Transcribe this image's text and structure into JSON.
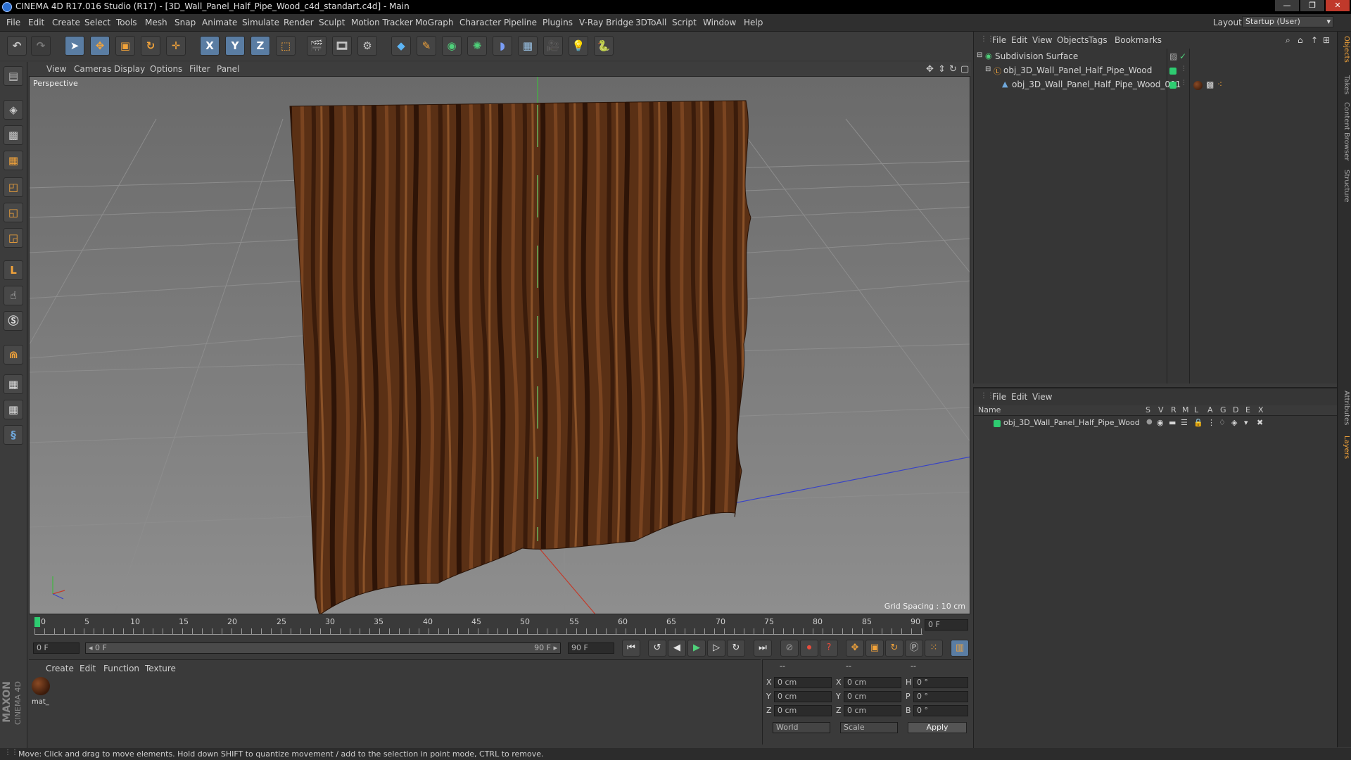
{
  "window": {
    "title": "CINEMA 4D R17.016 Studio (R17) - [3D_Wall_Panel_Half_Pipe_Wood_c4d_standart.c4d] - Main",
    "minimize": "—",
    "maximize": "❐",
    "close": "✕"
  },
  "menu": [
    "File",
    "Edit",
    "Create",
    "Select",
    "Tools",
    "Mesh",
    "Snap",
    "Animate",
    "Simulate",
    "Render",
    "Sculpt",
    "Motion Tracker",
    "MoGraph",
    "Character",
    "Pipeline",
    "Plugins",
    "V-Ray Bridge",
    "3DToAll",
    "Script",
    "Window",
    "Help"
  ],
  "layout": {
    "label": "Layout:",
    "value": "Startup (User)"
  },
  "toolbar": {
    "axis_x": "X",
    "axis_y": "Y",
    "axis_z": "Z"
  },
  "viewport": {
    "menu": [
      "View",
      "Cameras",
      "Display",
      "Options",
      "Filter",
      "Panel"
    ],
    "label": "Perspective",
    "grid_spacing": "Grid Spacing : 10 cm"
  },
  "timeline": {
    "ticks": [
      "0",
      "5",
      "10",
      "15",
      "20",
      "25",
      "30",
      "35",
      "40",
      "45",
      "50",
      "55",
      "60",
      "65",
      "70",
      "75",
      "80",
      "85",
      "90"
    ],
    "current_frame_field": "0 F",
    "start_field": "0 F",
    "range_start": "◂ 0 F",
    "range_end": "90 F ▸",
    "end_field": "90 F"
  },
  "material_panel": {
    "menu": [
      "Create",
      "Edit",
      "Function",
      "Texture"
    ],
    "material_name": "mat_"
  },
  "coord_panel": {
    "headers": [
      "--",
      "--",
      "--"
    ],
    "rows": [
      {
        "l1": "X",
        "v1": "0 cm",
        "l2": "X",
        "v2": "0 cm",
        "l3": "H",
        "v3": "0 °"
      },
      {
        "l1": "Y",
        "v1": "0 cm",
        "l2": "Y",
        "v2": "0 cm",
        "l3": "P",
        "v3": "0 °"
      },
      {
        "l1": "Z",
        "v1": "0 cm",
        "l2": "Z",
        "v2": "0 cm",
        "l3": "B",
        "v3": "0 °"
      }
    ],
    "mode": "World",
    "scale": "Scale",
    "apply": "Apply"
  },
  "object_manager": {
    "menu": [
      "File",
      "Edit",
      "View",
      "Objects",
      "Tags",
      "Bookmarks"
    ],
    "objects": [
      {
        "name": "Subdivision Surface"
      },
      {
        "name": "obj_3D_Wall_Panel_Half_Pipe_Wood"
      },
      {
        "name": "obj_3D_Wall_Panel_Half_Pipe_Wood_001"
      }
    ]
  },
  "layer_manager": {
    "menu": [
      "File",
      "Edit",
      "View"
    ],
    "columns": [
      "Name",
      "S",
      "V",
      "R",
      "M",
      "L",
      "A",
      "G",
      "D",
      "E",
      "X"
    ],
    "layers": [
      {
        "name": "obj_3D_Wall_Panel_Half_Pipe_Wood"
      }
    ]
  },
  "side_tabs": [
    "Objects",
    "Takes",
    "Content Browser",
    "Structure",
    "Attributes",
    "Layers"
  ],
  "brand": {
    "line1": "MAXON",
    "line2": "CINEMA 4D"
  },
  "status": "Move: Click and drag to move elements. Hold down SHIFT to quantize movement / add to the selection in point mode, CTRL to remove.",
  "colors": {
    "wood_dark": "#3b1c0b",
    "wood_light": "#7a4420",
    "green_tag": "#2ecc71",
    "accent_blue": "#5a7da3"
  }
}
